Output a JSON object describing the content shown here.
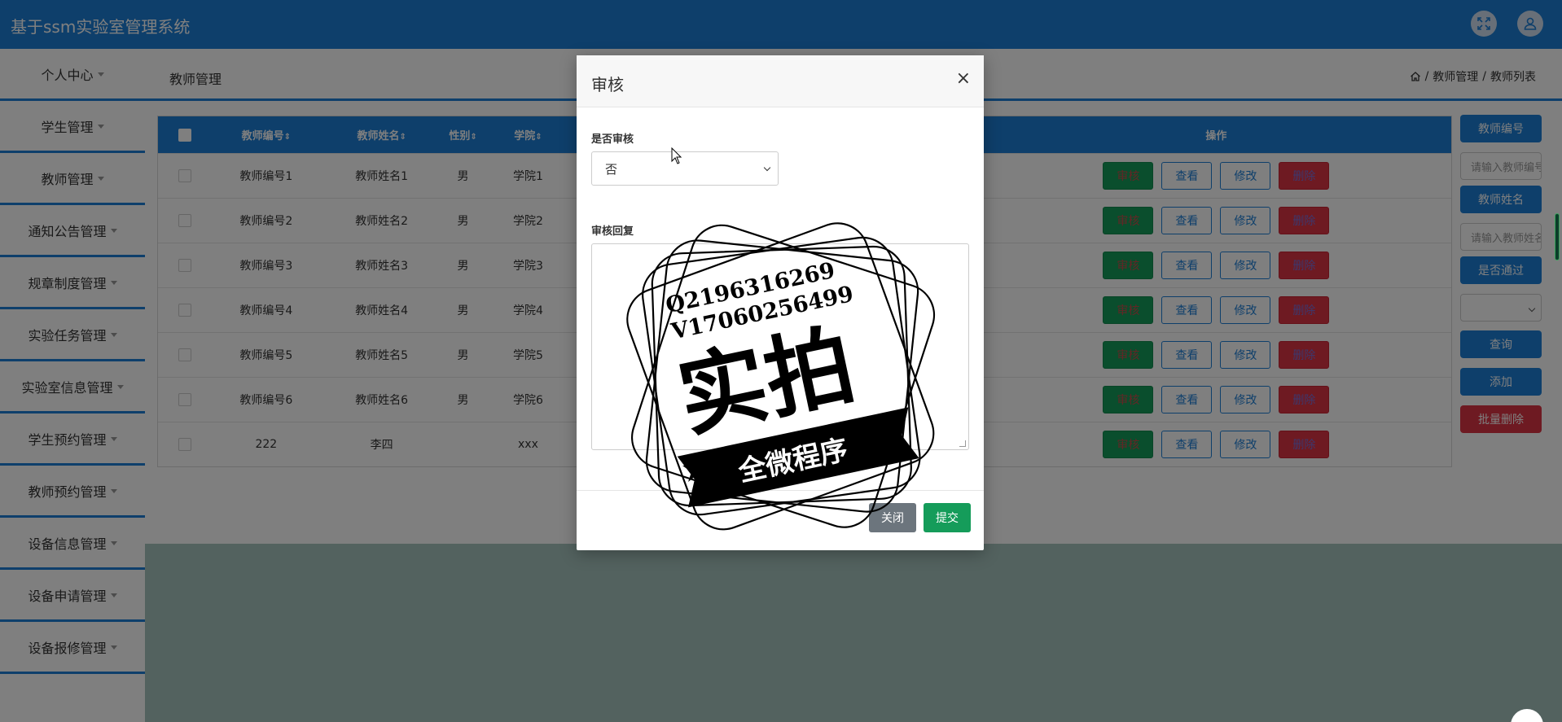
{
  "app": {
    "title": "基于ssm实验室管理系统"
  },
  "header": {
    "icons": [
      "fullscreen-icon",
      "user-icon"
    ]
  },
  "sidebar": {
    "items": [
      {
        "label": "个人中心"
      },
      {
        "label": "学生管理"
      },
      {
        "label": "教师管理"
      },
      {
        "label": "通知公告管理"
      },
      {
        "label": "规章制度管理"
      },
      {
        "label": "实验任务管理"
      },
      {
        "label": "实验室信息管理"
      },
      {
        "label": "学生预约管理"
      },
      {
        "label": "教师预约管理"
      },
      {
        "label": "设备信息管理"
      },
      {
        "label": "设备申请管理"
      },
      {
        "label": "设备报修管理"
      }
    ]
  },
  "page": {
    "title": "教师管理",
    "breadcrumb": [
      "/",
      "教师管理",
      "/",
      "教师列表"
    ]
  },
  "table": {
    "columns": {
      "no": "教师编号",
      "name": "教师姓名",
      "sex": "性别",
      "college": "学院",
      "ops": "操作"
    },
    "sort_glyph": "⇕",
    "rows": [
      {
        "no": "教师编号1",
        "name": "教师姓名1",
        "sex": "男",
        "college": "学院1"
      },
      {
        "no": "教师编号2",
        "name": "教师姓名2",
        "sex": "男",
        "college": "学院2"
      },
      {
        "no": "教师编号3",
        "name": "教师姓名3",
        "sex": "男",
        "college": "学院3"
      },
      {
        "no": "教师编号4",
        "name": "教师姓名4",
        "sex": "男",
        "college": "学院4"
      },
      {
        "no": "教师编号5",
        "name": "教师姓名5",
        "sex": "男",
        "college": "学院5"
      },
      {
        "no": "教师编号6",
        "name": "教师姓名6",
        "sex": "男",
        "college": "学院6"
      },
      {
        "no": "222",
        "name": "李四",
        "sex": "",
        "college": "xxx"
      }
    ],
    "row_actions": {
      "audit": "审核",
      "view": "查看",
      "edit": "修改",
      "delete": "删除"
    }
  },
  "search_panel": {
    "teacher_no_label": "教师编号",
    "teacher_no_placeholder": "请输入教师编号",
    "teacher_name_label": "教师姓名",
    "teacher_name_placeholder": "请输入教师姓名",
    "approved_label": "是否通过",
    "approved_value": "",
    "query": "查询",
    "add": "添加",
    "batch_delete": "批量删除"
  },
  "modal": {
    "title": "审核",
    "close_glyph": "×",
    "audit_label": "是否审核",
    "audit_value": "否",
    "reply_label": "审核回复",
    "reply_value": "",
    "close_button": "关闭",
    "submit_button": "提交"
  },
  "watermark": {
    "line1": "Q2196316269",
    "line2": "V17060256499",
    "big": "实拍",
    "banner": "全微程序"
  },
  "colors": {
    "primary": "#1c7ed6",
    "success": "#159c5a",
    "danger": "#dc3545",
    "secondary": "#6c757d"
  }
}
